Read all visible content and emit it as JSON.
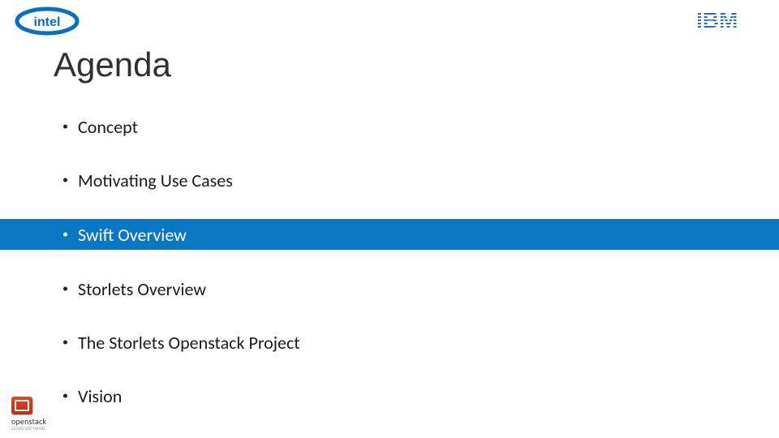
{
  "title": "Agenda",
  "bullets": [
    {
      "label": "Concept"
    },
    {
      "label": "Motivating Use Cases"
    },
    {
      "label": "Swift Overview",
      "highlight": true
    },
    {
      "label": "Storlets Overview"
    },
    {
      "label": "The Storlets Openstack Project"
    },
    {
      "label": "Vision"
    }
  ],
  "logos": {
    "intel": "intel",
    "ibm": "IBM",
    "openstack_word": "openstack",
    "openstack_tag": "CLOUD SOFTWARE"
  },
  "colors": {
    "highlight": "#0a77c3",
    "intel_blue": "#0071c5",
    "ibm_blue": "#1f70c1"
  }
}
